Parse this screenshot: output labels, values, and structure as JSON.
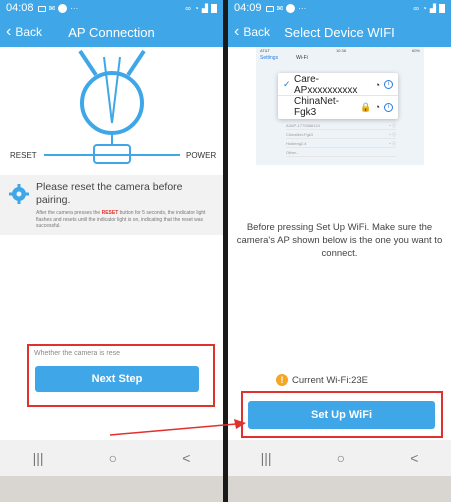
{
  "colors": {
    "accent": "#3fa7e8",
    "highlight": "#e0312e",
    "warning": "#f5a623"
  },
  "left": {
    "status": {
      "time": "04:08"
    },
    "nav": {
      "back_label": "Back",
      "title": "AP Connection"
    },
    "diagram": {
      "reset_label": "RESET",
      "power_label": "POWER"
    },
    "tip": {
      "title": "Please reset the camera before pairing.",
      "body_pre": "After the camera presses the ",
      "body_key": "RESET",
      "body_post": " button for 5 seconds, the indicator light flashes and resets until the indicator light is on, indicating that the reset was successful."
    },
    "hint": "Whether the camera is rese",
    "next_button": "Next Step",
    "navkeys": {
      "recents": "|||",
      "home": "○",
      "back": "<"
    }
  },
  "right": {
    "status": {
      "time": "04:09"
    },
    "nav": {
      "back_label": "Back",
      "title": "Select Device WIFI"
    },
    "mock": {
      "carrier": "AT&T",
      "time": "10:38",
      "battery": "60%",
      "settings_label": "Settings",
      "wifi_label": "Wi-Fi",
      "selected_network": "Care-APxxxxxxxxxx",
      "second_network": "ChinaNet-Fgk3",
      "list": [
        "A3AP-1770588124",
        "ChinaNet-Fgk3",
        "Holdeng2.4",
        "Other..."
      ]
    },
    "instruction": "Before pressing Set Up WiFi. Make sure the camera's AP shown below is the one you want to connect.",
    "current_wifi": "Current Wi-Fi:23E",
    "setup_button": "Set Up WiFi",
    "navkeys": {
      "recents": "|||",
      "home": "○",
      "back": "<"
    }
  }
}
